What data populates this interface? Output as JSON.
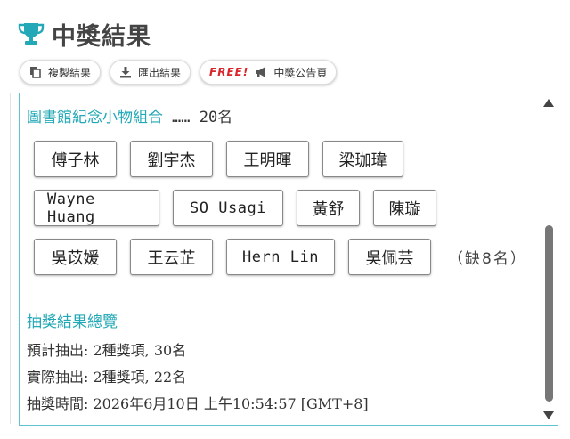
{
  "header": {
    "title": "中獎結果",
    "icon": "trophy-icon",
    "accent": "#22a8b6"
  },
  "toolbar": {
    "copy_label": "複製結果",
    "export_label": "匯出結果",
    "free_label": "FREE!",
    "announce_label": "中獎公告頁"
  },
  "prize": {
    "name": "圖書館紀念小物組合",
    "count": "…… 20名"
  },
  "winners": {
    "row1": [
      "傅子林",
      "劉宇杰",
      "王明暉",
      "梁珈瑋"
    ],
    "row2": [
      "Wayne Huang",
      "SO Usagi",
      "黃舒",
      "陳璇"
    ],
    "row3": [
      "吳苡媛",
      "王云芷",
      "Hern Lin",
      "吳佩芸"
    ],
    "missing": "（缺8名）"
  },
  "summary": {
    "title": "抽獎結果總覽",
    "planned": "預計抽出: 2種獎項, 30名",
    "actual": "實際抽出: 2種獎項, 22名",
    "time": "抽獎時間: 2026年6月10日 上午10:54:57 [GMT+8]"
  }
}
